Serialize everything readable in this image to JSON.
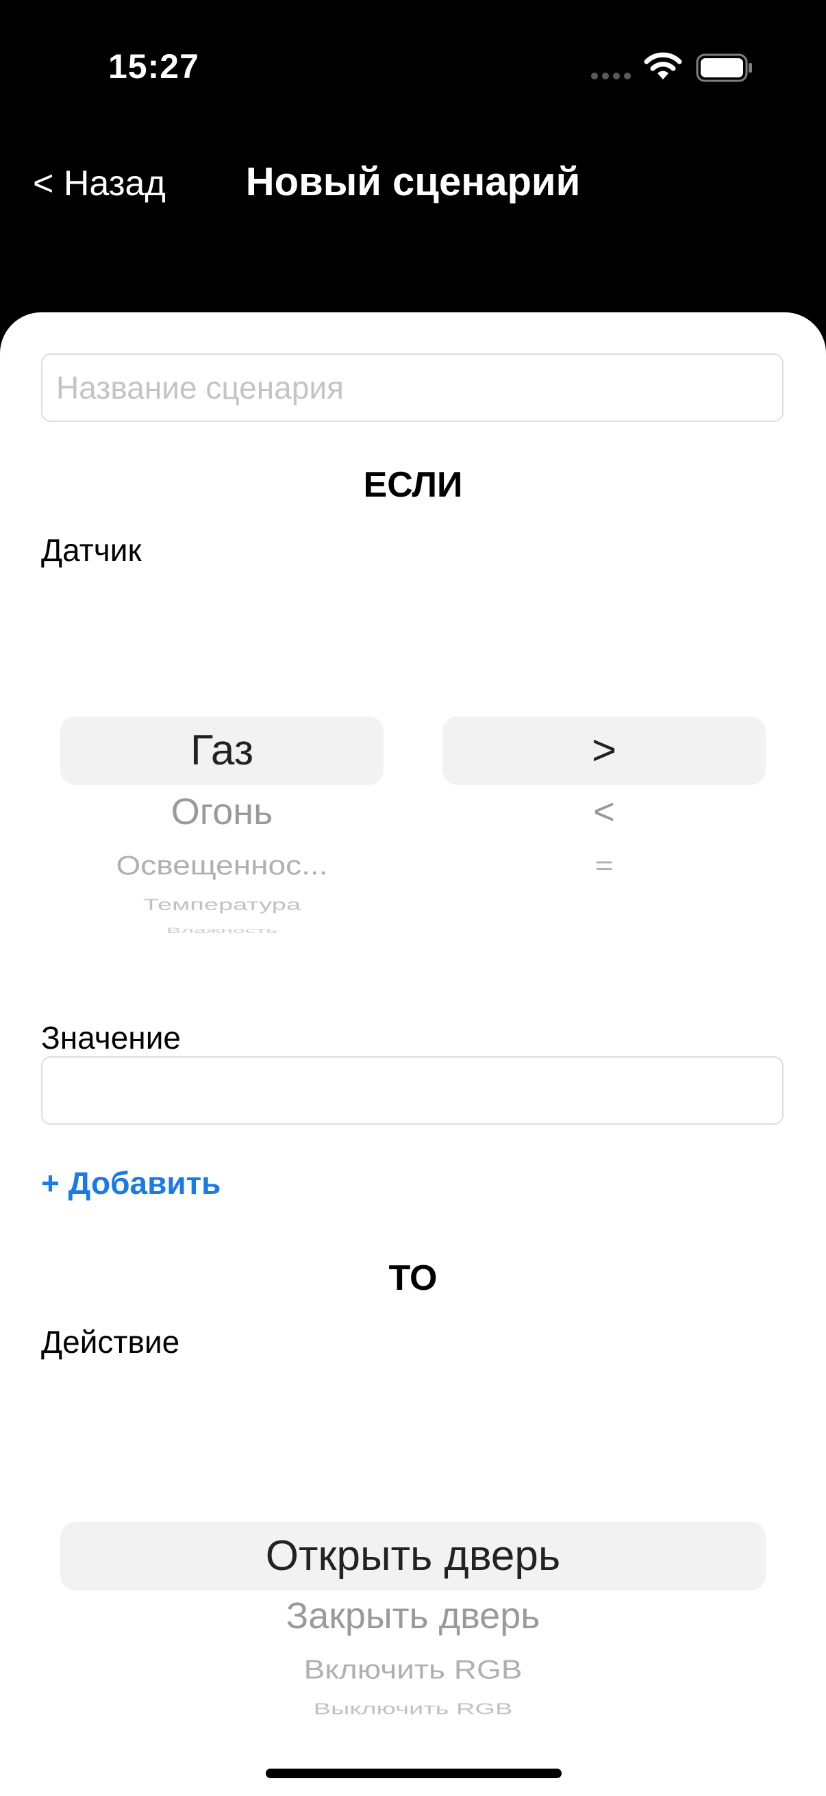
{
  "status_bar": {
    "time": "15:27",
    "icons": [
      "signal-icon",
      "wifi-icon",
      "battery-icon"
    ]
  },
  "nav": {
    "back_label": "< Назад",
    "title": "Новый сценарий"
  },
  "form": {
    "name_placeholder": "Название сценария",
    "name_value": "",
    "if_heading": "ЕСЛИ",
    "sensor_label": "Датчик",
    "sensor_picker": {
      "selected": "Газ",
      "options": [
        "Газ",
        "Огонь",
        "Освещеннос...",
        "Температура",
        "Влажность"
      ]
    },
    "operator_picker": {
      "selected": ">",
      "options": [
        ">",
        "<",
        "="
      ]
    },
    "value_label": "Значение",
    "value_input": "",
    "add_label": "+ Добавить",
    "then_heading": "ТО",
    "action_label": "Действие",
    "action_picker": {
      "selected": "Открыть дверь",
      "options": [
        "Открыть дверь",
        "Закрыть дверь",
        "Включить RGB",
        "Выключить RGB"
      ]
    }
  },
  "colors": {
    "accent": "#1a7ae8",
    "background": "#000000",
    "sheet": "#ffffff",
    "picker_selection": "#f2f2f2"
  }
}
